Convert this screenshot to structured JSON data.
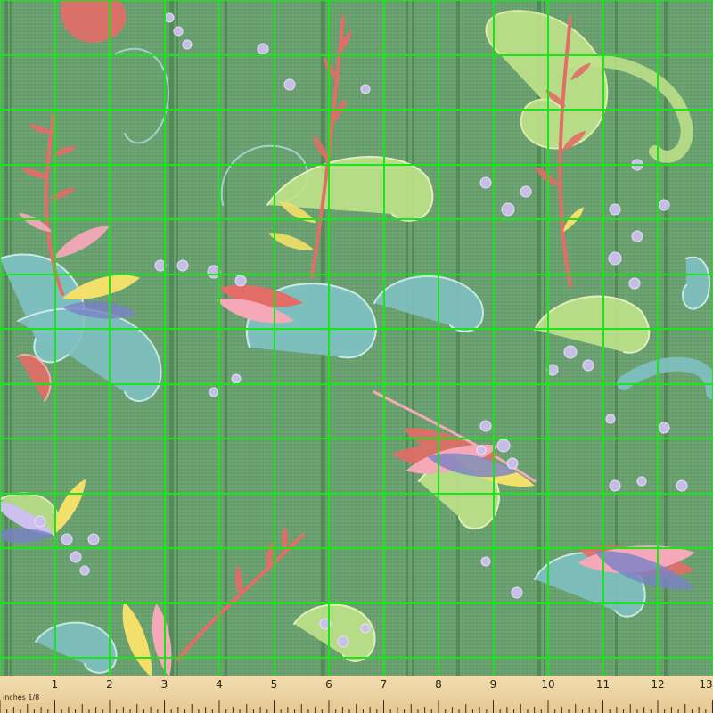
{
  "fabric": {
    "background_color": "#6aa070",
    "stripe_color": "#4a8450",
    "grid_color": "#19e619",
    "palette": [
      "#e46d68",
      "#f5a8b8",
      "#f3e06a",
      "#7fc1c2",
      "#bfe38a",
      "#cdbfee",
      "#7a82c8"
    ]
  },
  "ruler": {
    "units_label": "inches 1/8",
    "numbers": [
      "1",
      "2",
      "3",
      "4",
      "5",
      "6",
      "7",
      "8",
      "9",
      "10",
      "11",
      "12",
      "13"
    ]
  }
}
